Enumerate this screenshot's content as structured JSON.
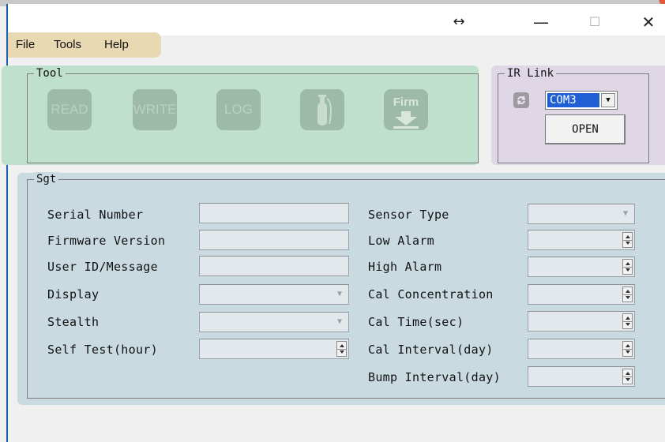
{
  "window": {
    "controls": {
      "resize": "↔",
      "minimize": "—",
      "maximize": "☐",
      "close": "✕"
    }
  },
  "menu": {
    "items": [
      "File",
      "Tools",
      "Help"
    ]
  },
  "tool_group": {
    "legend": "Tool",
    "buttons": {
      "read": "READ",
      "write": "WRITE",
      "log": "LOG",
      "cylinder_icon": "gas-cylinder-icon",
      "firm": "Firm"
    }
  },
  "ir_link": {
    "legend": "IR Link",
    "port_value": "COM3",
    "open_label": "OPEN"
  },
  "sgt": {
    "legend": "Sgt",
    "left_fields": [
      {
        "label": "Serial Number",
        "kind": "text"
      },
      {
        "label": "Firmware Version",
        "kind": "text"
      },
      {
        "label": "User ID/Message",
        "kind": "text"
      },
      {
        "label": "Display",
        "kind": "dropdown"
      },
      {
        "label": "Stealth",
        "kind": "dropdown"
      },
      {
        "label": "Self Test(hour)",
        "kind": "spinner"
      }
    ],
    "right_fields": [
      {
        "label": "Sensor Type",
        "kind": "dropdown"
      },
      {
        "label": "Low Alarm",
        "kind": "spinner"
      },
      {
        "label": "High Alarm",
        "kind": "spinner"
      },
      {
        "label": "Cal Concentration",
        "kind": "spinner"
      },
      {
        "label": "Cal Time(sec)",
        "kind": "spinner"
      },
      {
        "label": "Cal Interval(day)",
        "kind": "spinner"
      },
      {
        "label": "Bump Interval(day)",
        "kind": "spinner"
      }
    ]
  },
  "colors": {
    "tool_zone": "#bfe0cc",
    "ir_zone": "#dfd6e6",
    "sgt_zone": "#c9dae1",
    "menu_zone": "#e8d9b3",
    "disabled_button": "#9cbaa7"
  }
}
